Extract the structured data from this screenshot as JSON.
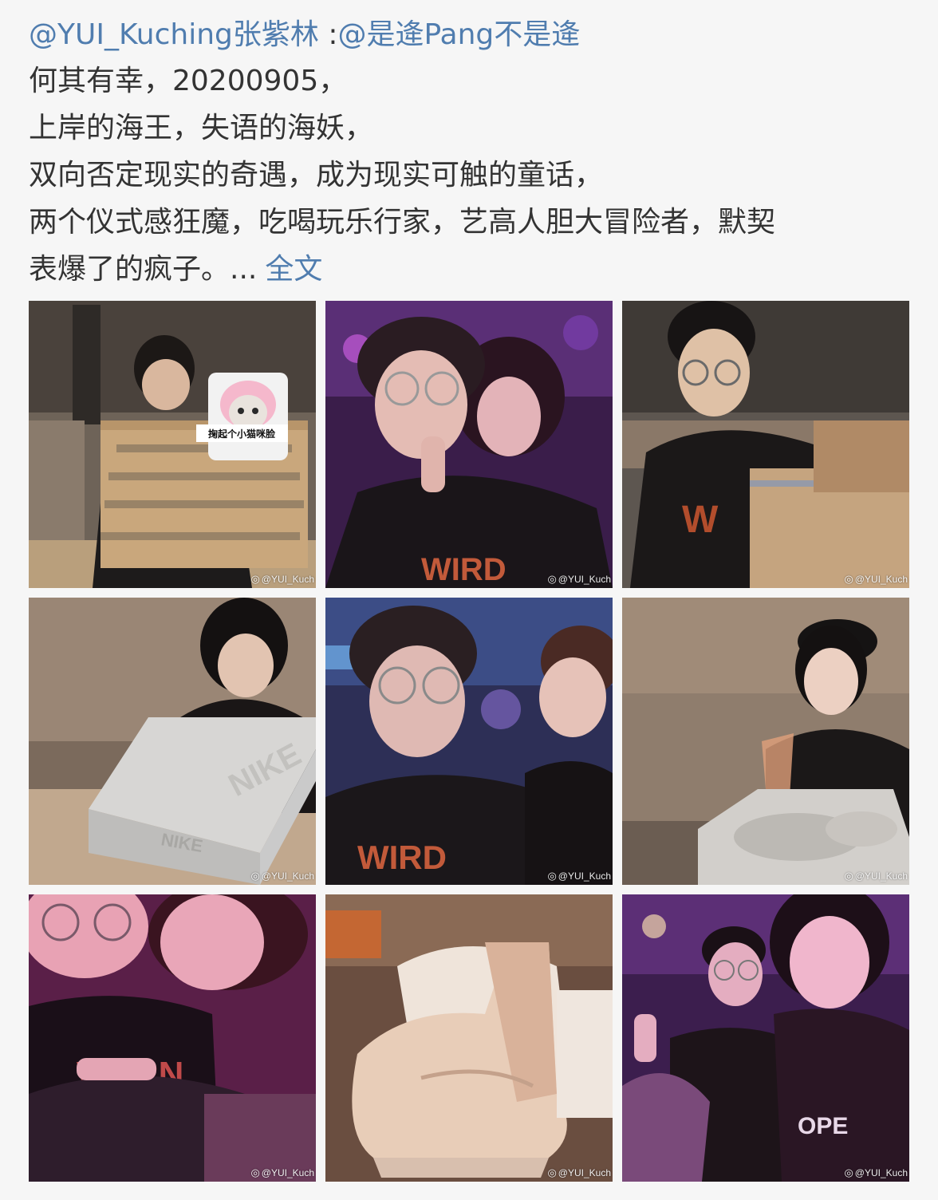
{
  "post": {
    "author": "@YUI_Kuching张紫林",
    "separator": " :",
    "mention": "@是逄Pang不是逄",
    "lines": [
      " 何其有幸，20200905，",
      "上岸的海王，失语的海妖，",
      "双向否定现实的奇遇，成为现实可触的童话，",
      "两个仪式感狂魔，吃喝玩乐行家，艺高人胆大冒险者，默契",
      "表爆了的疯子。..."
    ],
    "more_label": "全文"
  },
  "colors": {
    "link": "#507daf",
    "text": "#333333",
    "background": "#f6f6f6"
  },
  "photos": [
    {
      "scene": "guy-with-cardboard-box",
      "sticker_text": "掬起个小猫咪脸",
      "watermark": "@YUI_Kuch"
    },
    {
      "scene": "couple-selfie-bar-purple",
      "watermark": "@YUI_Kuch"
    },
    {
      "scene": "guy-opening-box",
      "watermark": "@YUI_Kuch"
    },
    {
      "scene": "girl-with-shoebox",
      "box_text": "NIKE",
      "watermark": "@YUI_Kuch"
    },
    {
      "scene": "couple-selfie-bar-blue",
      "watermark": "@YUI_Kuch"
    },
    {
      "scene": "girl-with-sneakers",
      "watermark": "@YUI_Kuch"
    },
    {
      "scene": "couple-closeup-pink",
      "watermark": "@YUI_Kuch"
    },
    {
      "scene": "sneakers-closeup",
      "watermark": "@YUI_Kuch"
    },
    {
      "scene": "couple-selfie-magenta",
      "watermark": "@YUI_Kuch"
    }
  ],
  "watermark_icon": "weibo-logo-icon"
}
